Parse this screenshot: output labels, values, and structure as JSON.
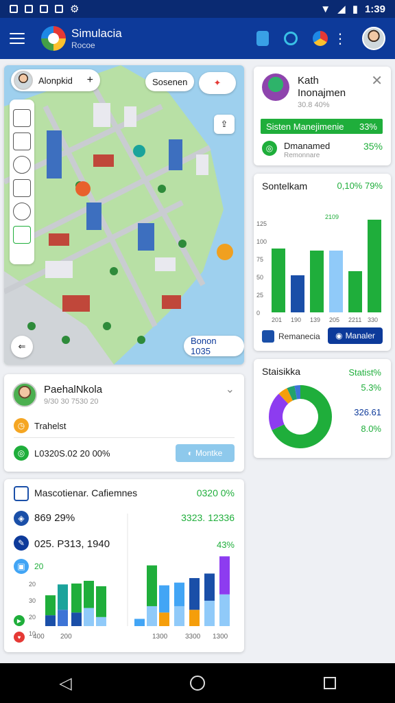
{
  "status_bar": {
    "time": "1:39"
  },
  "app_bar": {
    "title": "Simulacia",
    "subtitle": "Rocoe"
  },
  "map": {
    "top_pill": "Alonpkid",
    "top_pill_plus": "+",
    "search_pill": "Sosenen",
    "bottom_pill": "Bonon 1035"
  },
  "top_right_card": {
    "name_line1": "Kath",
    "name_line2": "Inonajmen",
    "meta": "30.8 40%",
    "bar_label": "Sisten Manejimenie",
    "bar_value": "33%",
    "row_label": "Dmanamed",
    "row_sub": "Remonnare",
    "row_value": "35%"
  },
  "bar_card": {
    "title": "Sontelkam",
    "value": "0,10% 79%",
    "peak_label": "2109",
    "btn_outline": "Remanecia",
    "btn_filled": "Manaler"
  },
  "donut_card": {
    "title": "Staisikka",
    "value_top": "Statist%",
    "value2": "5.3%",
    "value3": "326.61",
    "value4": "8.0%"
  },
  "profile_card": {
    "name": "PaehalNkola",
    "meta": "9/30 30 7530 20",
    "row1_label": "Trahelst",
    "row2_label": "L0320S.02 20 00%",
    "btn_label": "Montke"
  },
  "metrics_card": {
    "title": "Mascotienar. Cafiemnes",
    "title_value": "0320 0%",
    "row1": "869 29%",
    "row2": "025. P313, 1940",
    "row3": "20",
    "right_value1": "3323. 12336",
    "right_value2": "43%"
  },
  "chart_data": [
    {
      "type": "bar",
      "title": "Sontelkam",
      "categories": [
        "201",
        "190",
        "139",
        "205",
        "2211",
        "330"
      ],
      "series": [
        {
          "name": "",
          "values": [
            2.3,
            1.8,
            0,
            2.5,
            0,
            0
          ]
        },
        {
          "name": "",
          "values": [
            0,
            0,
            1.5,
            0,
            0,
            0
          ]
        },
        {
          "name": "",
          "values": [
            0,
            0,
            0,
            3.0,
            0,
            0
          ]
        },
        {
          "name": "",
          "values": [
            3.1,
            0,
            3.0,
            0,
            2.0,
            4.5
          ]
        }
      ],
      "yticks": [
        "",
        "125",
        "100",
        "75",
        "50",
        "25",
        "0"
      ]
    },
    {
      "type": "pie",
      "title": "Staisikka",
      "labels": [
        "",
        "",
        "",
        "",
        ""
      ],
      "values": [
        68,
        20,
        5,
        4,
        3
      ],
      "colors": [
        "#1fae3b",
        "#8d3cf0",
        "#f59e0b",
        "#22a26b",
        "#3d74d6"
      ]
    },
    {
      "type": "bar",
      "title": "Mascotienar. Cafiemnes",
      "categories": [
        "400",
        "200",
        "1300",
        "3300",
        "1300"
      ],
      "yticks": [
        "20",
        "30",
        "20",
        "10"
      ],
      "series": [
        {
          "name": "",
          "values": [
            3,
            2.5,
            3.2,
            2.8,
            3.5,
            2.2,
            4.5
          ]
        },
        {
          "name": "",
          "values": [
            1.2,
            1.8,
            1.5,
            2,
            1,
            1.2,
            2.8
          ]
        }
      ]
    }
  ]
}
